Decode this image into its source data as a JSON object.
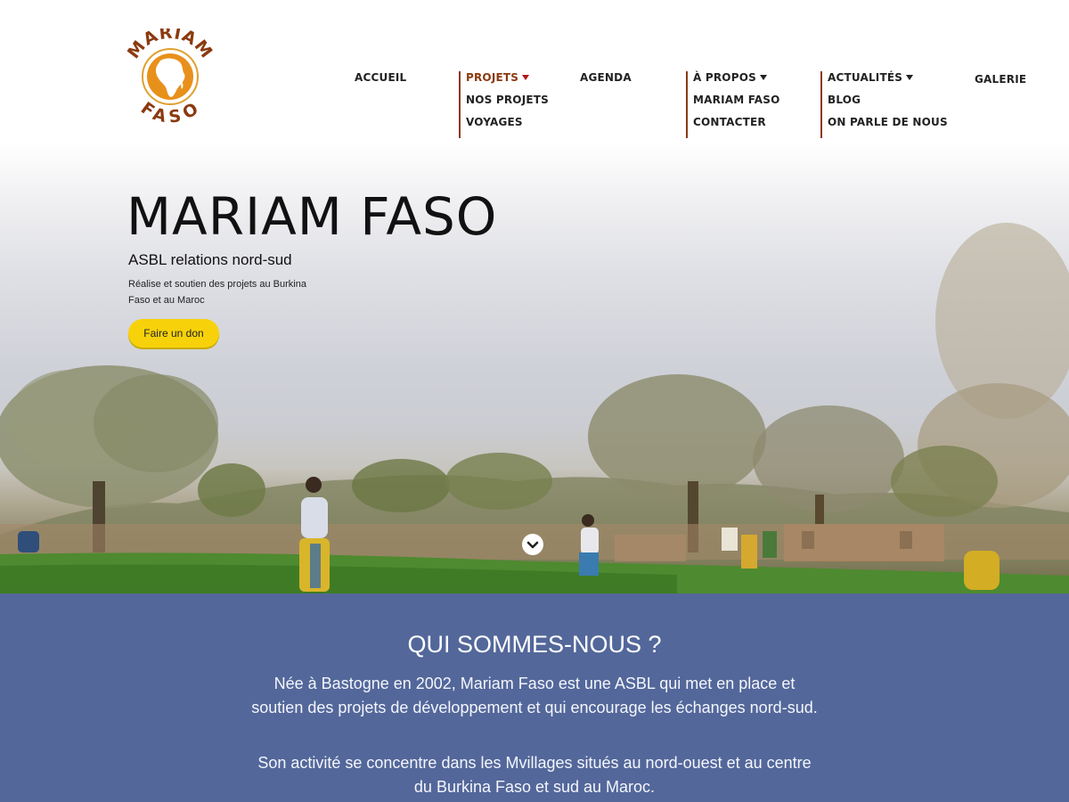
{
  "brand": {
    "logo_top": "MARIAM",
    "logo_bottom": "FASO",
    "colors": {
      "logo_brown": "#8a3a10",
      "logo_orange": "#e0881a",
      "accent_red": "#b01818"
    }
  },
  "nav": {
    "accueil": "ACCUEIL",
    "projets": "PROJETS",
    "nos_projets": "NOS PROJETS",
    "voyages": "VOYAGES",
    "agenda": "AGENDA",
    "a_propos": "À PROPOS",
    "mariam_faso": "MARIAM FASO",
    "contacter": "CONTACTER",
    "actualites": "ACTUALITÉS",
    "blog": "BLOG",
    "on_parle": "ON PARLE DE NOUS",
    "galerie": "GALERIE"
  },
  "hero": {
    "title": "MARIAM FASO",
    "subtitle": "ASBL relations nord-sud",
    "description": "Réalise et soutien des projets au Burkina Faso et au Maroc",
    "donate_label": "Faire un don",
    "colors": {
      "button": "#f7d20a"
    },
    "icons": {
      "scroll": "chevron-down-icon"
    }
  },
  "about": {
    "title": "QUI SOMMES-NOUS ?",
    "paragraph1": "Née à Bastogne en 2002, Mariam Faso est une ASBL qui met en place et soutien des projets de développement et qui encourage les échanges nord-sud.",
    "paragraph2": "Son activité se concentre dans les Mvillages situés au nord-ouest et au centre du Burkina Faso et sud au Maroc.",
    "colors": {
      "background": "#53679a"
    }
  }
}
